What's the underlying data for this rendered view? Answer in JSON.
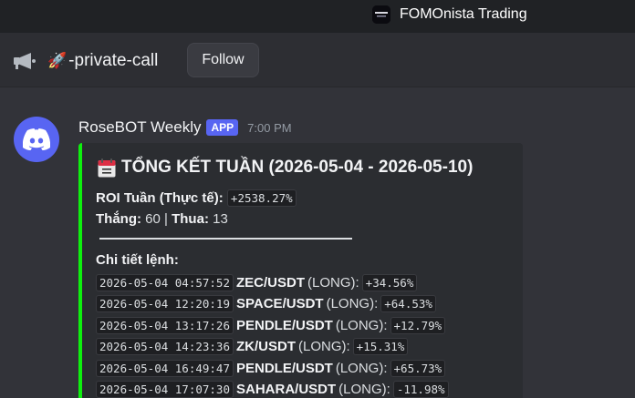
{
  "server": {
    "name": "FOMOnista Trading",
    "icon": "server-logo-icon"
  },
  "channel": {
    "emoji": "🚀",
    "name": "-private-call",
    "icon": "announcement-megaphone-icon",
    "follow_label": "Follow"
  },
  "message": {
    "author": "RoseBOT Weekly",
    "badge": "APP",
    "time": "7:00 PM",
    "accent_color": "#0ef00e",
    "embed": {
      "title_icon": "calendar-icon",
      "title": "TỔNG KẾT TUẦN (2026-05-04 - 2026-05-10)",
      "roi_label": "ROI Tuần (Thực tế):",
      "roi_value": "+2538.27%",
      "wins_label": "Thắng:",
      "wins_value": "60",
      "sep": "|",
      "losses_label": "Thua:",
      "losses_value": "13",
      "details_label": "Chi tiết lệnh:",
      "trades": [
        {
          "time": "2026-05-04 04:57:52",
          "pair": "ZEC/USDT",
          "side": "(LONG):",
          "pnl": "+34.56%"
        },
        {
          "time": "2026-05-04 12:20:19",
          "pair": "SPACE/USDT",
          "side": "(LONG):",
          "pnl": "+64.53%"
        },
        {
          "time": "2026-05-04 13:17:26",
          "pair": "PENDLE/USDT",
          "side": "(LONG):",
          "pnl": "+12.79%"
        },
        {
          "time": "2026-05-04 14:23:36",
          "pair": "ZK/USDT",
          "side": "(LONG):",
          "pnl": "+15.31%"
        },
        {
          "time": "2026-05-04 16:49:47",
          "pair": "PENDLE/USDT",
          "side": "(LONG):",
          "pnl": "+65.73%"
        },
        {
          "time": "2026-05-04 17:07:30",
          "pair": "SAHARA/USDT",
          "side": "(LONG):",
          "pnl": "-11.98%"
        }
      ]
    }
  }
}
